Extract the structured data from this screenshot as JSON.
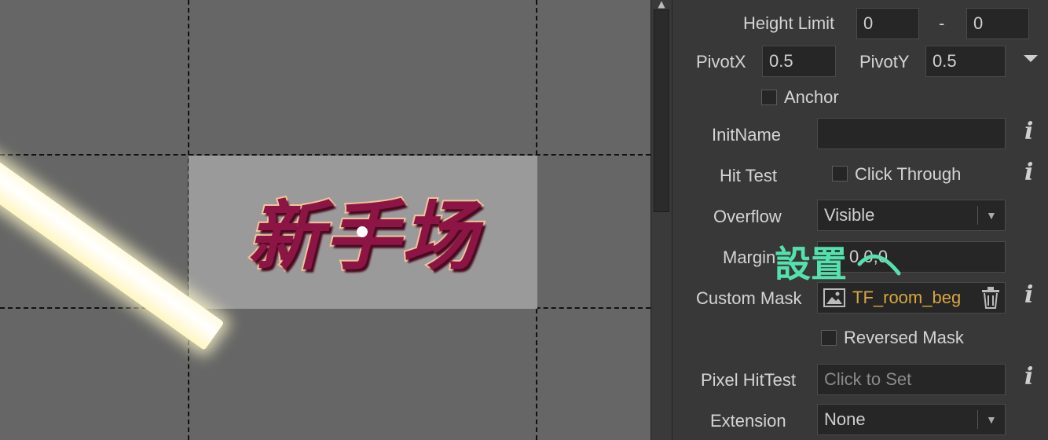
{
  "canvas": {
    "title_text": "新手场"
  },
  "inspector": {
    "height_limit": {
      "label": "Height Limit",
      "min": "0",
      "separator": "-",
      "max": "0"
    },
    "pivot": {
      "x_label": "PivotX",
      "x_value": "0.5",
      "y_label": "PivotY",
      "y_value": "0.5"
    },
    "anchor": {
      "label": "Anchor",
      "checked": false
    },
    "init_name": {
      "label": "InitName",
      "value": ""
    },
    "hit_test": {
      "label": "Hit Test",
      "option_label": "Click Through",
      "checked": false
    },
    "overflow": {
      "label": "Overflow",
      "value": "Visible"
    },
    "margin": {
      "label": "Margin",
      "value": "0,0,0"
    },
    "custom_mask": {
      "label": "Custom Mask",
      "value": "TF_room_beg"
    },
    "reversed_mask": {
      "label": "Reversed Mask",
      "checked": false
    },
    "pixel_hittest": {
      "label": "Pixel HitTest",
      "placeholder": "Click to Set"
    },
    "extension": {
      "label": "Extension",
      "value": "None"
    }
  },
  "overlay": {
    "text": "設置"
  },
  "colors": {
    "accent_overlay": "#55e0ad",
    "mask_text": "#d8a640",
    "title_fill": "#8c1545"
  }
}
